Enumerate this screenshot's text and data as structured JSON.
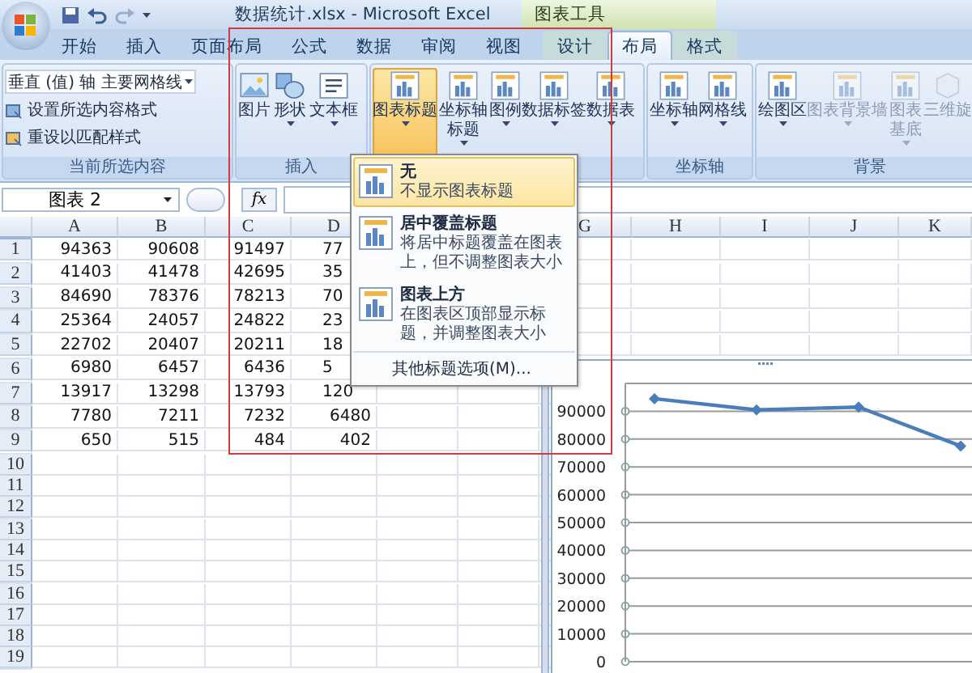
{
  "window": {
    "title": "数据统计.xlsx - Microsoft Excel",
    "context_label": "图表工具"
  },
  "tabs": [
    {
      "label": "开始",
      "selected": false,
      "contextual": false
    },
    {
      "label": "插入",
      "selected": false,
      "contextual": false
    },
    {
      "label": "页面布局",
      "selected": false,
      "contextual": false
    },
    {
      "label": "公式",
      "selected": false,
      "contextual": false
    },
    {
      "label": "数据",
      "selected": false,
      "contextual": false
    },
    {
      "label": "审阅",
      "selected": false,
      "contextual": false
    },
    {
      "label": "视图",
      "selected": false,
      "contextual": false
    },
    {
      "label": "设计",
      "selected": false,
      "contextual": true
    },
    {
      "label": "布局",
      "selected": true,
      "contextual": true
    },
    {
      "label": "格式",
      "selected": false,
      "contextual": true
    }
  ],
  "ribbon": {
    "groups": [
      {
        "kind": "selection",
        "label": "当前所选内容",
        "dropdown": "垂直 (值) 轴 主要网格线",
        "items": [
          "设置所选内容格式",
          "重设以匹配样式"
        ]
      },
      {
        "kind": "buttons",
        "label": "插入",
        "buttons": [
          {
            "label": "图片",
            "dropdown": false,
            "open": false,
            "disabled": false
          },
          {
            "label": "形状",
            "dropdown": true,
            "open": false,
            "disabled": false
          },
          {
            "label": "文本框",
            "dropdown": true,
            "open": false,
            "disabled": false
          }
        ]
      },
      {
        "kind": "buttons",
        "buttons": [
          {
            "label": "图表标题",
            "dropdown": true,
            "open": true,
            "disabled": false
          },
          {
            "label": "坐标轴标题",
            "dropdown": true,
            "open": false,
            "disabled": false
          },
          {
            "label": "图例",
            "dropdown": true,
            "open": false,
            "disabled": false
          },
          {
            "label": "数据标签",
            "dropdown": true,
            "open": false,
            "disabled": false
          },
          {
            "label": "数据表",
            "dropdown": true,
            "open": false,
            "disabled": false
          }
        ]
      },
      {
        "kind": "buttons",
        "label": "坐标轴",
        "buttons": [
          {
            "label": "坐标轴",
            "dropdown": true,
            "open": false,
            "disabled": false
          },
          {
            "label": "网格线",
            "dropdown": true,
            "open": false,
            "disabled": false
          }
        ]
      },
      {
        "kind": "buttons",
        "label": "背景",
        "buttons": [
          {
            "label": "绘图区",
            "dropdown": true,
            "open": false,
            "disabled": false
          },
          {
            "label": "图表背景墙",
            "dropdown": true,
            "open": false,
            "disabled": true
          },
          {
            "label": "图表基底",
            "dropdown": true,
            "open": false,
            "disabled": true
          },
          {
            "label": "三维旋",
            "dropdown": false,
            "open": false,
            "disabled": true
          }
        ]
      }
    ]
  },
  "formula_bar": {
    "name_box": "图表 2",
    "function_label": "fx"
  },
  "sheet": {
    "columns": [
      {
        "label": "A"
      },
      {
        "label": "B"
      },
      {
        "label": "C"
      },
      {
        "label": "D"
      },
      {},
      {},
      {
        "label": "G"
      },
      {
        "label": "H"
      },
      {
        "label": "I"
      },
      {
        "label": "J"
      },
      {
        "label": "K"
      }
    ],
    "rows": [
      {
        "header": "1",
        "clipped": true,
        "cells": [
          "94363",
          "90608",
          "91497",
          "77"
        ]
      },
      {
        "header": "2",
        "clipped": true,
        "cells": [
          "41403",
          "41478",
          "42695",
          "35"
        ]
      },
      {
        "header": "3",
        "clipped": true,
        "cells": [
          "84690",
          "78376",
          "78213",
          "70"
        ]
      },
      {
        "header": "4",
        "clipped": true,
        "cells": [
          "25364",
          "24057",
          "24822",
          "23"
        ]
      },
      {
        "header": "5",
        "clipped": true,
        "cells": [
          "22702",
          "20407",
          "20211",
          "18"
        ]
      },
      {
        "header": "6",
        "clipped": true,
        "cells": [
          "6980",
          "6457",
          "6436",
          "5"
        ]
      },
      {
        "header": "7",
        "clipped": true,
        "cells": [
          "13917",
          "13298",
          "13793",
          "120"
        ]
      },
      {
        "header": "8",
        "clipped": false,
        "cells": [
          "7780",
          "7211",
          "7232",
          "6480"
        ]
      },
      {
        "header": "9",
        "clipped": false,
        "cells": [
          "650",
          "515",
          "484",
          "402"
        ]
      },
      {
        "header": "10"
      },
      {
        "header": "11"
      },
      {
        "header": "12"
      },
      {
        "header": "13"
      },
      {
        "header": "14"
      },
      {
        "header": "15"
      },
      {
        "header": "16"
      },
      {
        "header": "17"
      },
      {
        "header": "18"
      },
      {
        "header": "19"
      }
    ]
  },
  "chart": {
    "chart_data": {
      "type": "line",
      "ylim": [
        0,
        100000
      ],
      "grid": true,
      "yticks": [
        {
          "value": 0,
          "label": "0"
        },
        {
          "value": 10000,
          "label": "10000"
        },
        {
          "value": 20000,
          "label": "20000"
        },
        {
          "value": 30000,
          "label": "30000"
        },
        {
          "value": 40000,
          "label": "40000"
        },
        {
          "value": 50000,
          "label": "50000"
        },
        {
          "value": 60000,
          "label": "60000"
        },
        {
          "value": 70000,
          "label": "70000"
        },
        {
          "value": 80000,
          "label": "80000"
        },
        {
          "value": 90000,
          "label": "90000"
        }
      ],
      "series": [
        {
          "color": "#4a7ebb",
          "marker": "diamond",
          "values": [
            94500,
            90500,
            91500,
            77500
          ]
        }
      ]
    }
  },
  "menu": {
    "items": [
      {
        "title": "无",
        "description": "不显示图表标题",
        "selected": true
      },
      {
        "title": "居中覆盖标题",
        "description": "将居中标题覆盖在图表上，但不调整图表大小",
        "selected": false
      },
      {
        "title": "图表上方",
        "description": "在图表区顶部显示标题，并调整图表大小",
        "selected": false
      }
    ],
    "footer": "其他标题选项(M)..."
  }
}
